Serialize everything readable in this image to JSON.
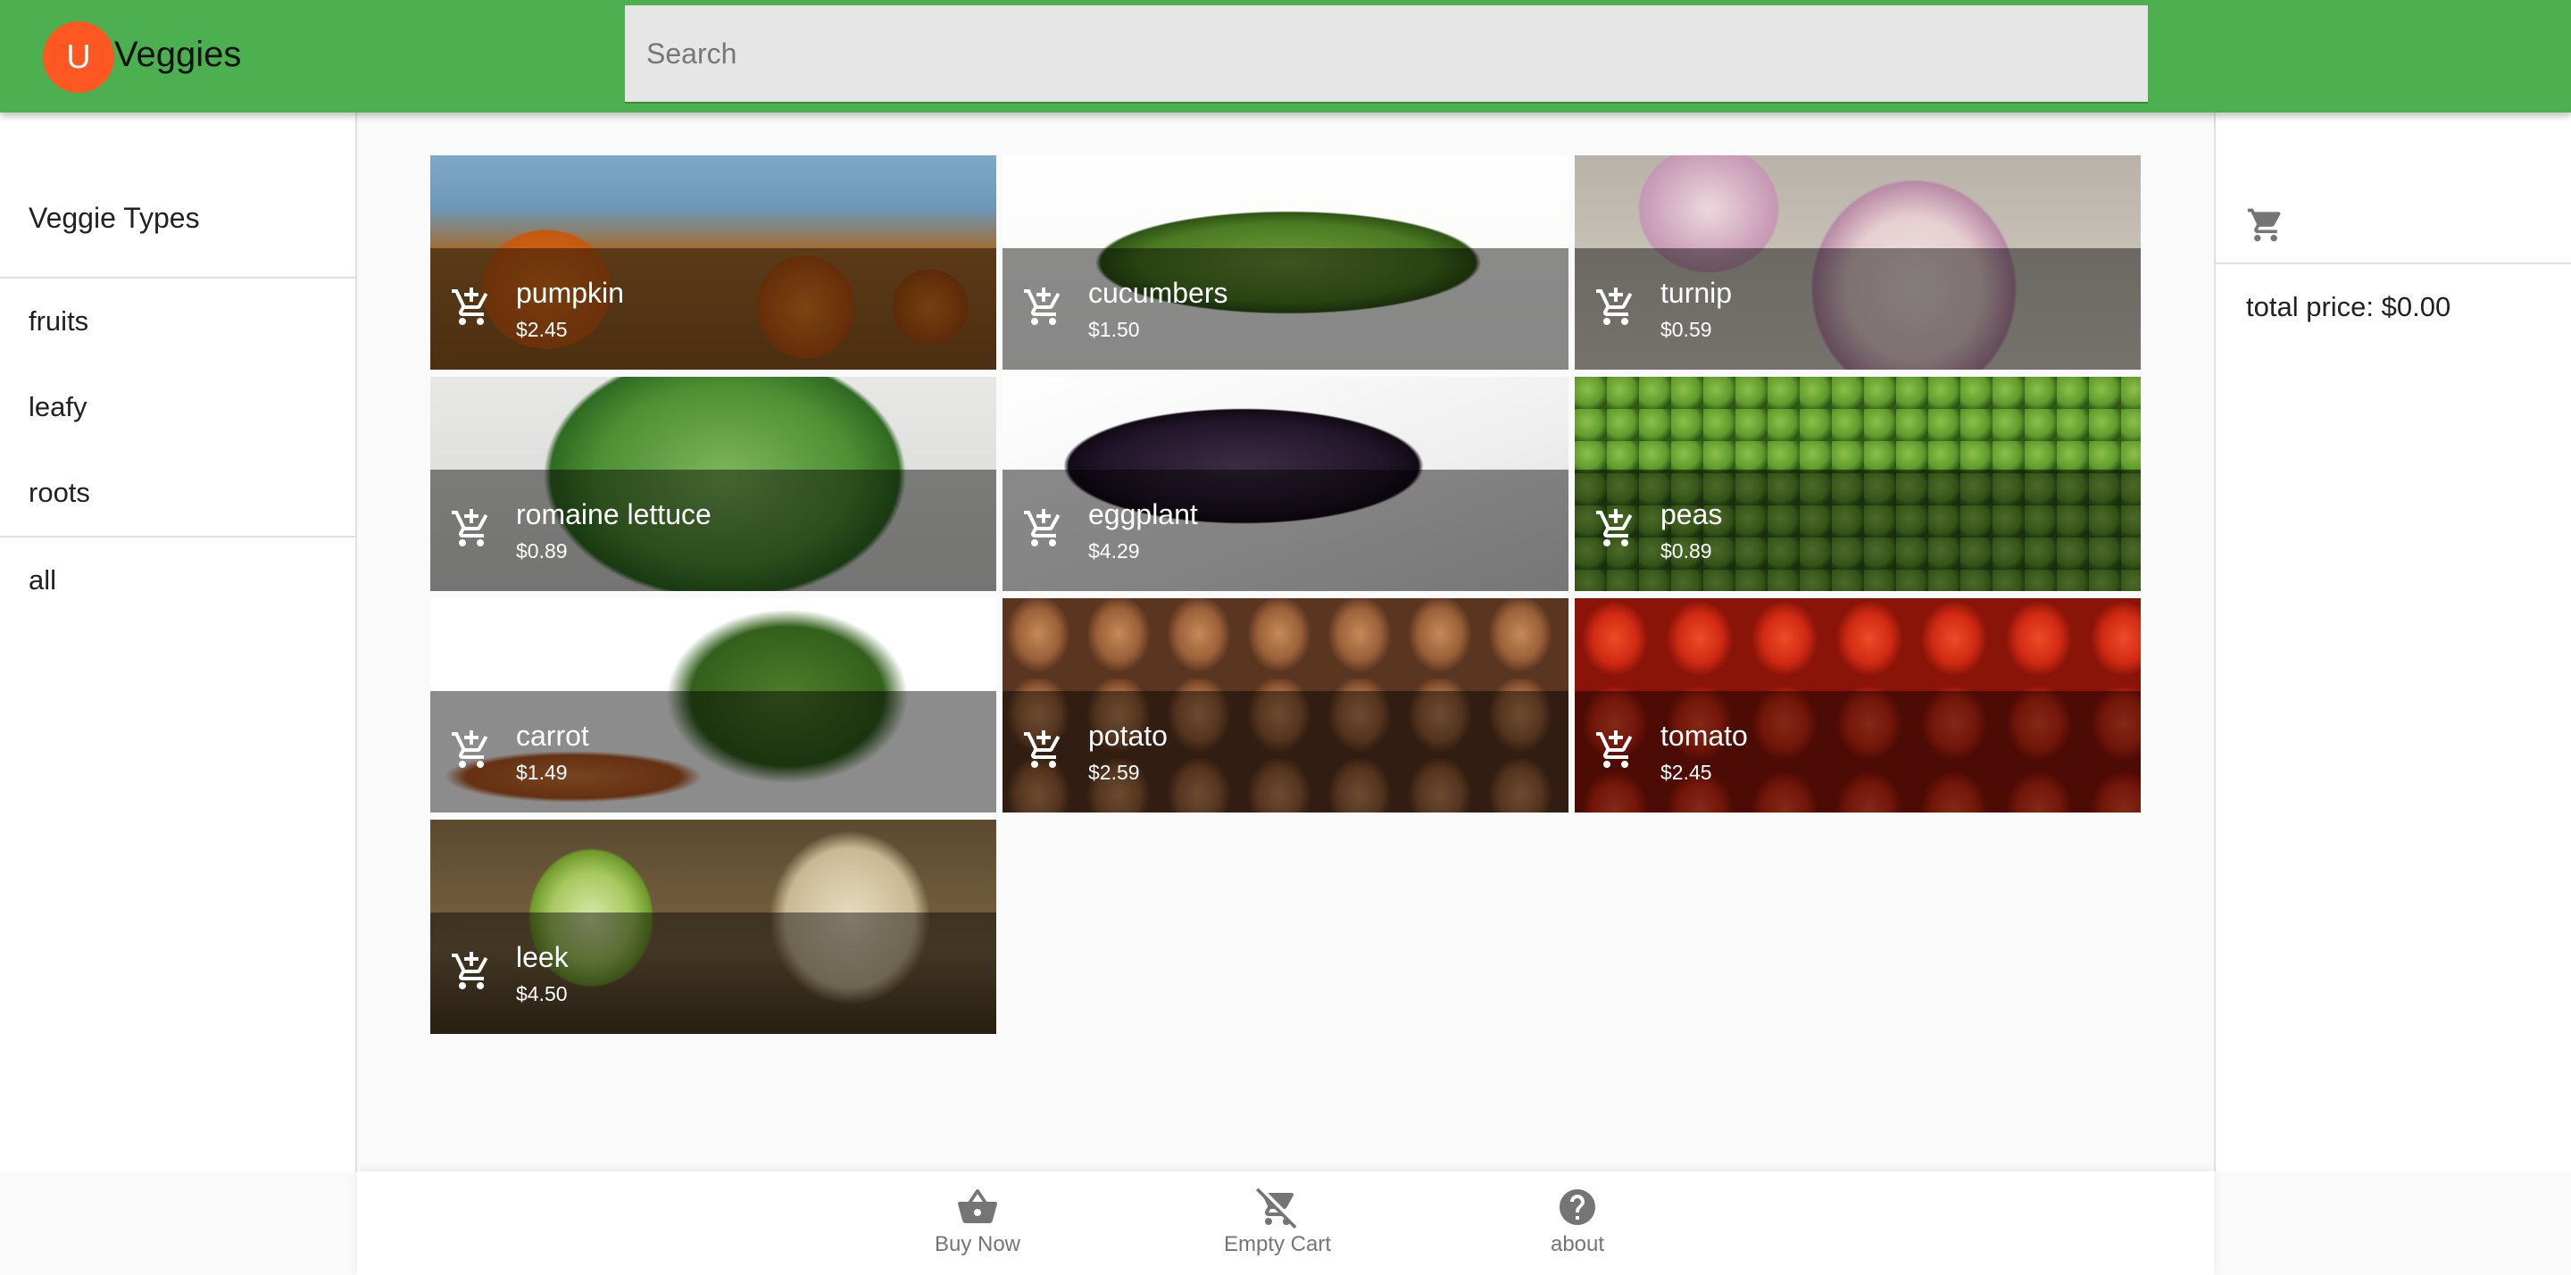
{
  "header": {
    "avatar_letter": "U",
    "title": "Veggies",
    "search_placeholder": "Search",
    "avatar_color": "#ff5722",
    "bar_color": "#4caf50"
  },
  "sidebar": {
    "subheader": "Veggie Types",
    "items": [
      {
        "label": "fruits"
      },
      {
        "label": "leafy"
      },
      {
        "label": "roots"
      }
    ],
    "all_label": "all"
  },
  "cart": {
    "icon": "shopping-cart-icon",
    "total_label": "total price: $0.00"
  },
  "products": [
    {
      "name": "pumpkin",
      "price": "$2.45"
    },
    {
      "name": "cucumbers",
      "price": "$1.50"
    },
    {
      "name": "turnip",
      "price": "$0.59"
    },
    {
      "name": "romaine lettuce",
      "price": "$0.89"
    },
    {
      "name": "eggplant",
      "price": "$4.29"
    },
    {
      "name": "peas",
      "price": "$0.89"
    },
    {
      "name": "carrot",
      "price": "$1.49"
    },
    {
      "name": "potato",
      "price": "$2.59"
    },
    {
      "name": "tomato",
      "price": "$2.45"
    },
    {
      "name": "leek",
      "price": "$4.50"
    }
  ],
  "bottom_nav": [
    {
      "label": "Buy Now",
      "icon": "basket-icon"
    },
    {
      "label": "Empty Cart",
      "icon": "remove-shopping-cart-icon"
    },
    {
      "label": "about",
      "icon": "help-circle-icon"
    }
  ]
}
